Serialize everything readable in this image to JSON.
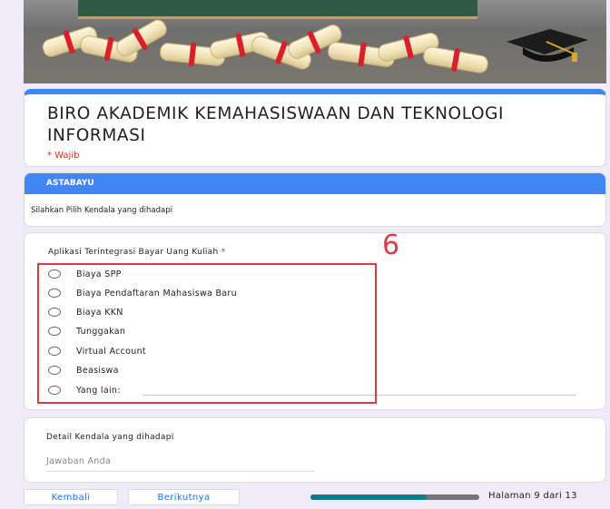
{
  "form": {
    "title": "BIRO AKADEMIK KEMAHASISWAAN DAN TEKNOLOGI INFORMASI",
    "required_note": "* Wajib"
  },
  "section": {
    "header": "ASTABAYU",
    "description": "Silahkan Pilih Kendala yang dihadapi"
  },
  "question": {
    "title": "Aplikasi Terintegrasi Bayar Uang Kuliah",
    "required_mark": "*",
    "options": [
      "Biaya SPP",
      "Biaya Pendaftaran Mahasiswa Baru",
      "Biaya KKN",
      "Tunggakan",
      "Virtual Account",
      "Beasiswa",
      "Yang lain:"
    ]
  },
  "annotation": {
    "number": "6",
    "color": "#dd3b42"
  },
  "detail": {
    "title": "Detail Kendala yang dihadapi",
    "placeholder": "Jawaban Anda"
  },
  "footer": {
    "back_label": "Kembali",
    "next_label": "Berikutnya",
    "progress_fraction": 0.69,
    "page_text": "Halaman 9 dari 13"
  },
  "colors": {
    "accent": "#4285f4",
    "required": "#d93025",
    "progress": "#0d7c8c"
  }
}
